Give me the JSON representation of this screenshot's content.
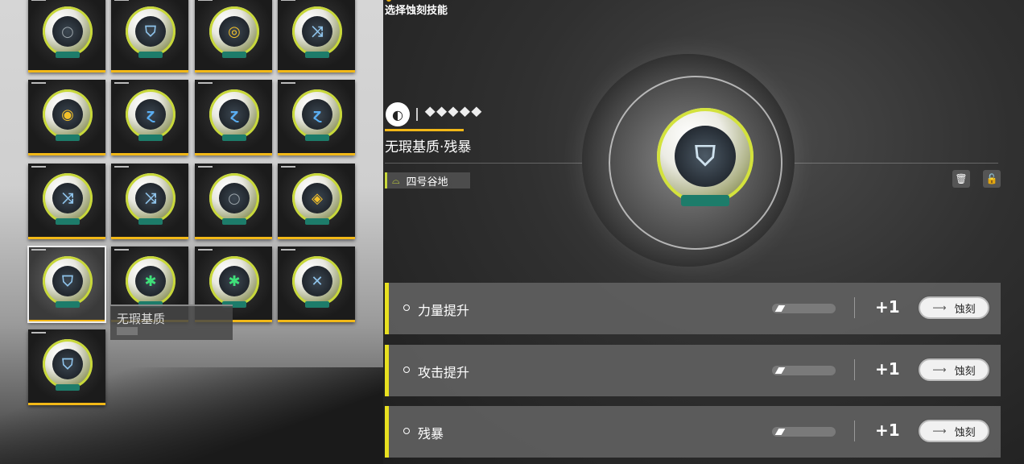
{
  "header": {
    "title": "选择蚀刻技能"
  },
  "grid": {
    "cards": [
      {
        "glyph": "○",
        "color": "#9aa3a8"
      },
      {
        "glyph": "⛉",
        "color": "#8fc4ec"
      },
      {
        "glyph": "◎",
        "color": "#f2c02a"
      },
      {
        "glyph": "⤨",
        "color": "#8fc4ec"
      },
      {
        "glyph": "◉",
        "color": "#f2c02a"
      },
      {
        "glyph": "ɀ",
        "color": "#5aaef2"
      },
      {
        "glyph": "ɀ",
        "color": "#5aaef2"
      },
      {
        "glyph": "ɀ",
        "color": "#5aaef2"
      },
      {
        "glyph": "⤨",
        "color": "#8fc4ec"
      },
      {
        "glyph": "⤨",
        "color": "#8fc4ec"
      },
      {
        "glyph": "○",
        "color": "#9aa3a8"
      },
      {
        "glyph": "◈",
        "color": "#f2c02a"
      },
      {
        "glyph": "⛉",
        "color": "#8fc4ec"
      },
      {
        "glyph": "✱",
        "color": "#3fe07a"
      },
      {
        "glyph": "✱",
        "color": "#3fe07a"
      },
      {
        "glyph": "✕",
        "color": "#8fc4ec"
      },
      {
        "glyph": "⛉",
        "color": "#8fc4ec"
      }
    ]
  },
  "tooltip": {
    "name": "无瑕基质"
  },
  "detail": {
    "set_icon": "◐",
    "rank_glyphs": "⯁⯁⯁⯁⯁",
    "item_name": "无瑕基质·残暴",
    "location": "四号谷地",
    "location_icon": "⌓",
    "delete_icon": "🗑",
    "lock_icon": "🔓",
    "big_glyph": "⛉"
  },
  "skills": [
    {
      "label": "力量提升",
      "bonus": "+1",
      "button": "蚀刻"
    },
    {
      "label": "攻击提升",
      "bonus": "+1",
      "button": "蚀刻"
    },
    {
      "label": "残暴",
      "bonus": "+1",
      "button": "蚀刻"
    }
  ]
}
